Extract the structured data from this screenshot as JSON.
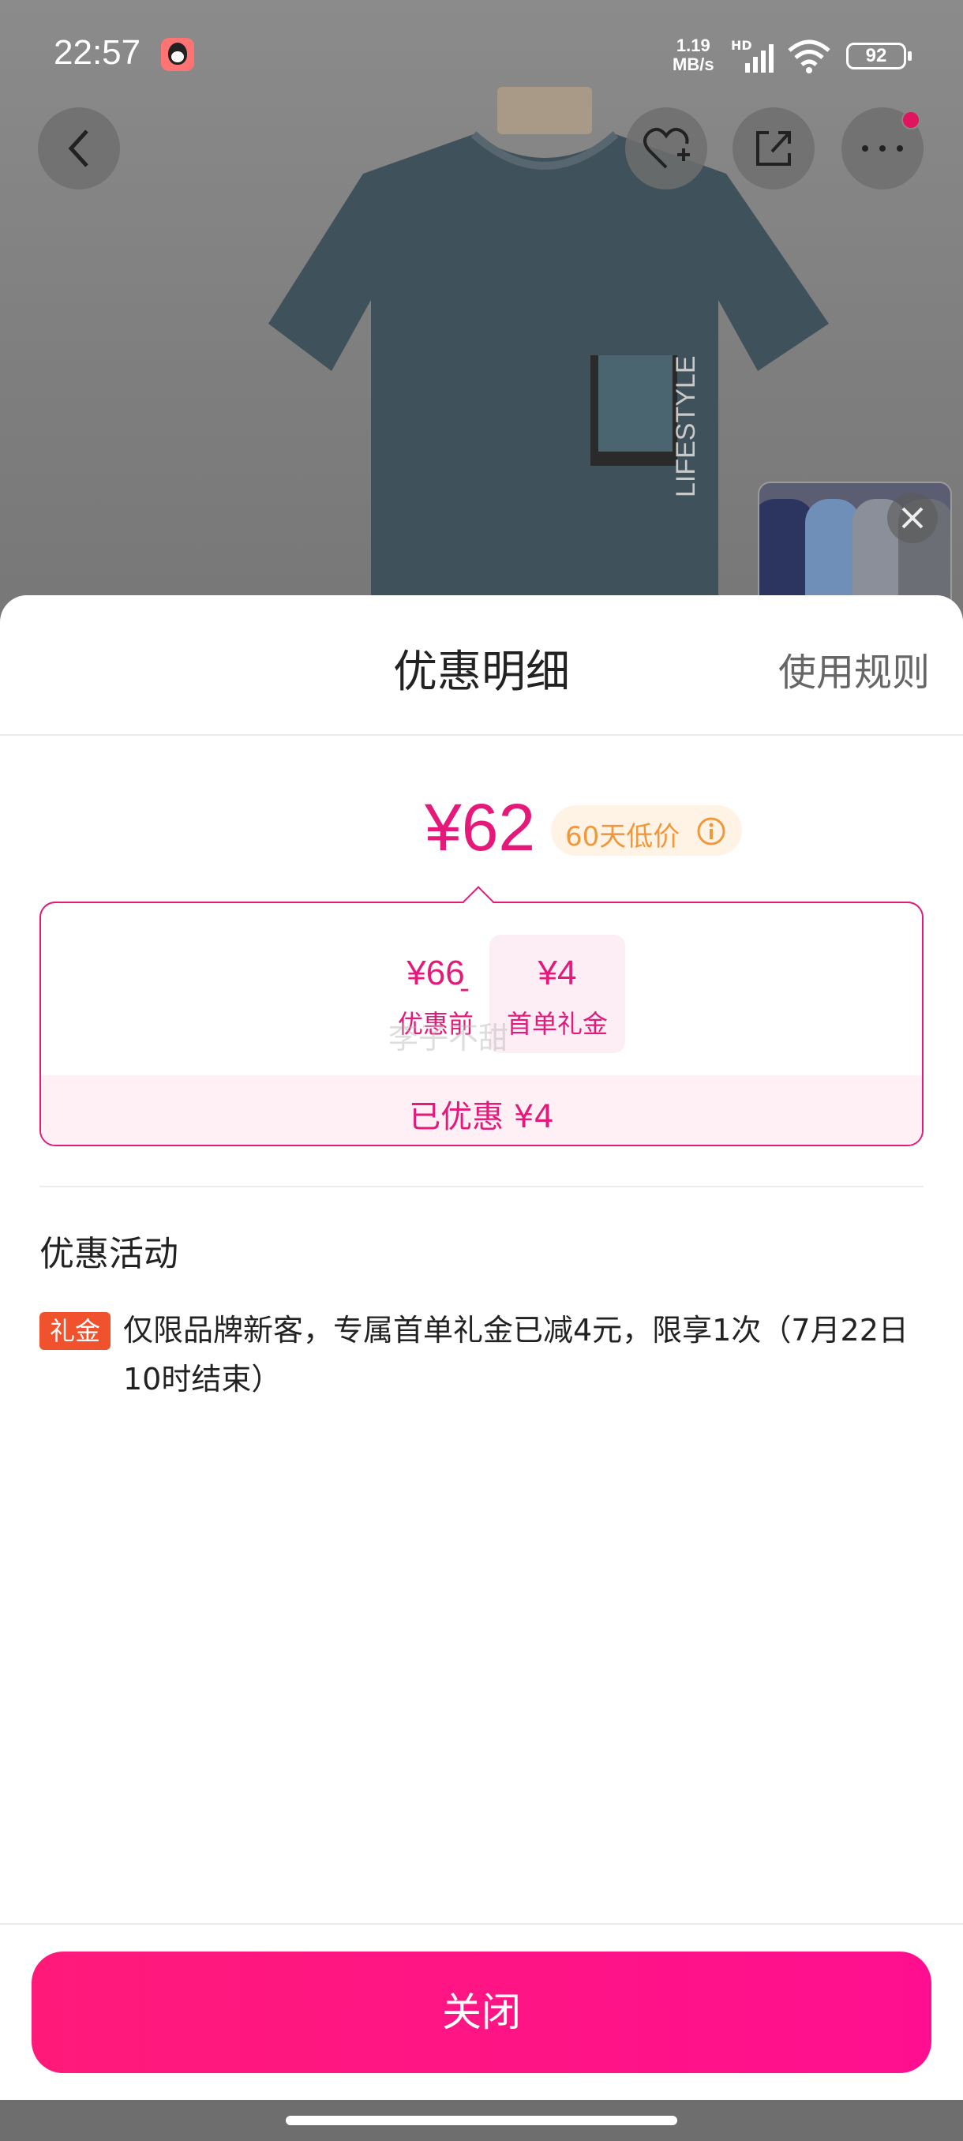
{
  "status_bar": {
    "time": "22:57",
    "net_speed_value": "1.19",
    "net_speed_unit": "MB/s",
    "network_label": "HD",
    "battery": "92",
    "icons": [
      "qq-icon",
      "signal-icon",
      "wifi-icon",
      "battery-icon"
    ]
  },
  "top_actions": [
    "back-icon",
    "favorite-add-icon",
    "share-icon",
    "more-icon"
  ],
  "sheet": {
    "title": "优惠明细",
    "rules_link": "使用规则",
    "final_price": "¥62",
    "low_price_badge": "60天低价",
    "calc": {
      "original_amount": "¥66",
      "original_label": "优惠前",
      "operator": "-",
      "discount_amount": "¥4",
      "discount_label": "首单礼金",
      "watermark": "李子不甜"
    },
    "saved_text": "已优惠 ¥4",
    "section_title": "优惠活动",
    "promotions": [
      {
        "tag": "礼金",
        "text": "仅限品牌新客，专属首单礼金已减4元，限享1次（7月22日10时结束）"
      }
    ],
    "close_button": "关闭"
  },
  "colors": {
    "accent": "#e4197a",
    "button": "#ff1a7a",
    "badge_text": "#f2973a",
    "tag_bg": "#f0522e"
  }
}
